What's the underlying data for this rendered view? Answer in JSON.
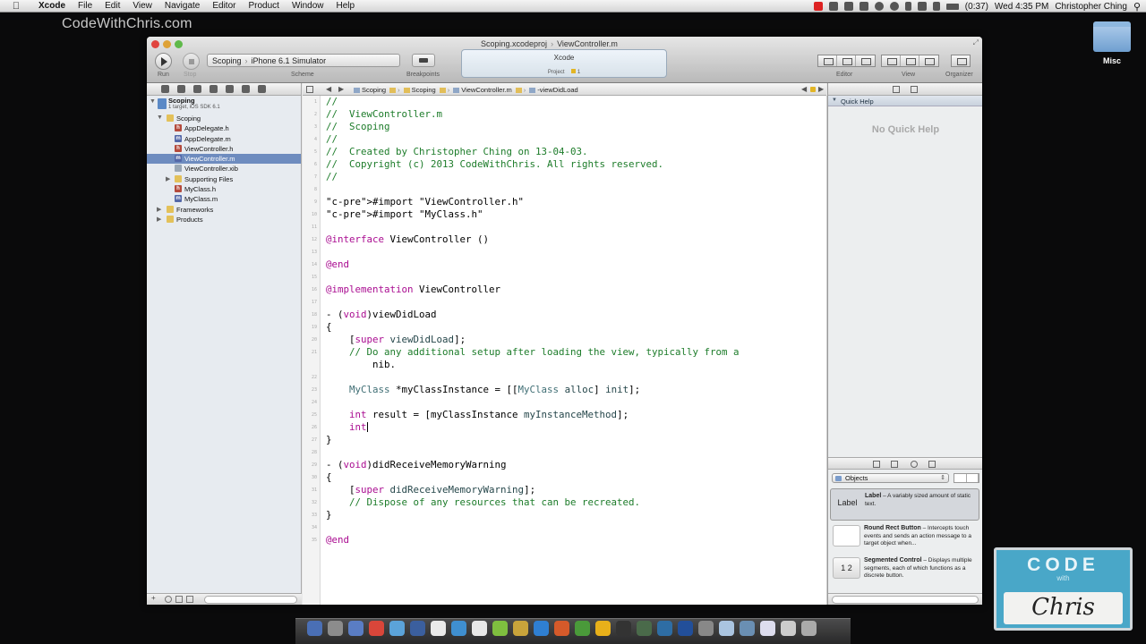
{
  "menubar": {
    "items": [
      "Xcode",
      "File",
      "Edit",
      "View",
      "Navigate",
      "Editor",
      "Product",
      "Window",
      "Help"
    ],
    "battery": "(0:37)",
    "clock": "Wed 4:35 PM",
    "user": "Christopher Ching"
  },
  "watermark": "CodeWithChris.com",
  "desktop_folder": "Misc",
  "window": {
    "title_project": "Scoping.xcodeproj",
    "title_file": "ViewController.m",
    "toolbar": {
      "run": "Run",
      "stop": "Stop",
      "scheme_target": "Scoping",
      "scheme_device": "iPhone 6.1 Simulator",
      "scheme_label": "Scheme",
      "breakpoints": "Breakpoints",
      "activity_title": "Xcode",
      "activity_sub": "Project",
      "activity_count": "1",
      "editor": "Editor",
      "view": "View",
      "organizer": "Organizer"
    }
  },
  "navigator": {
    "project_name": "Scoping",
    "project_sub": "1 target, iOS SDK 6.1",
    "items": [
      {
        "label": "Scoping",
        "kind": "folder"
      },
      {
        "label": "AppDelegate.h",
        "kind": "h"
      },
      {
        "label": "AppDelegate.m",
        "kind": "m"
      },
      {
        "label": "ViewController.h",
        "kind": "h"
      },
      {
        "label": "ViewController.m",
        "kind": "m"
      },
      {
        "label": "ViewController.xib",
        "kind": "xib"
      },
      {
        "label": "Supporting Files",
        "kind": "folder"
      },
      {
        "label": "MyClass.h",
        "kind": "h"
      },
      {
        "label": "MyClass.m",
        "kind": "m"
      },
      {
        "label": "Frameworks",
        "kind": "folder"
      },
      {
        "label": "Products",
        "kind": "folder"
      }
    ],
    "footer_add": "+"
  },
  "jumpbar": {
    "crumbs": [
      "Scoping",
      "Scoping",
      "ViewController.m",
      "-viewDidLoad"
    ]
  },
  "code": {
    "lines": [
      "//",
      "//  ViewController.m",
      "//  Scoping",
      "//",
      "//  Created by Christopher Ching on 13-04-03.",
      "//  Copyright (c) 2013 CodeWithChris. All rights reserved.",
      "//",
      "",
      "#import \"ViewController.h\"",
      "#import \"MyClass.h\"",
      "",
      "@interface ViewController ()",
      "",
      "@end",
      "",
      "@implementation ViewController",
      "",
      "- (void)viewDidLoad",
      "{",
      "    [super viewDidLoad];",
      "    // Do any additional setup after loading the view, typically from a",
      "        nib.",
      "",
      "    MyClass *myClassInstance = [[MyClass alloc] init];",
      "",
      "    int result = [myClassInstance myInstanceMethod];",
      "    int",
      "}",
      "",
      "- (void)didReceiveMemoryWarning",
      "{",
      "    [super didReceiveMemoryWarning];",
      "    // Dispose of any resources that can be recreated.",
      "}",
      "",
      "@end"
    ]
  },
  "inspector": {
    "quick_help_title": "Quick Help",
    "no_quick_help": "No Quick Help",
    "library_popup": "Objects",
    "library_items": [
      {
        "thumb": "Label",
        "title": "Label",
        "desc": " – A variably sized amount of static text."
      },
      {
        "thumb": "",
        "title": "Round Rect Button",
        "desc": " – Intercepts touch events and sends an action message to a target object when..."
      },
      {
        "thumb": "1 2",
        "title": "Segmented Control",
        "desc": " – Displays multiple segments, each of which functions as a discrete button."
      }
    ]
  },
  "logo": {
    "line1": "CODE",
    "line2": "with",
    "line3": "Chris"
  }
}
